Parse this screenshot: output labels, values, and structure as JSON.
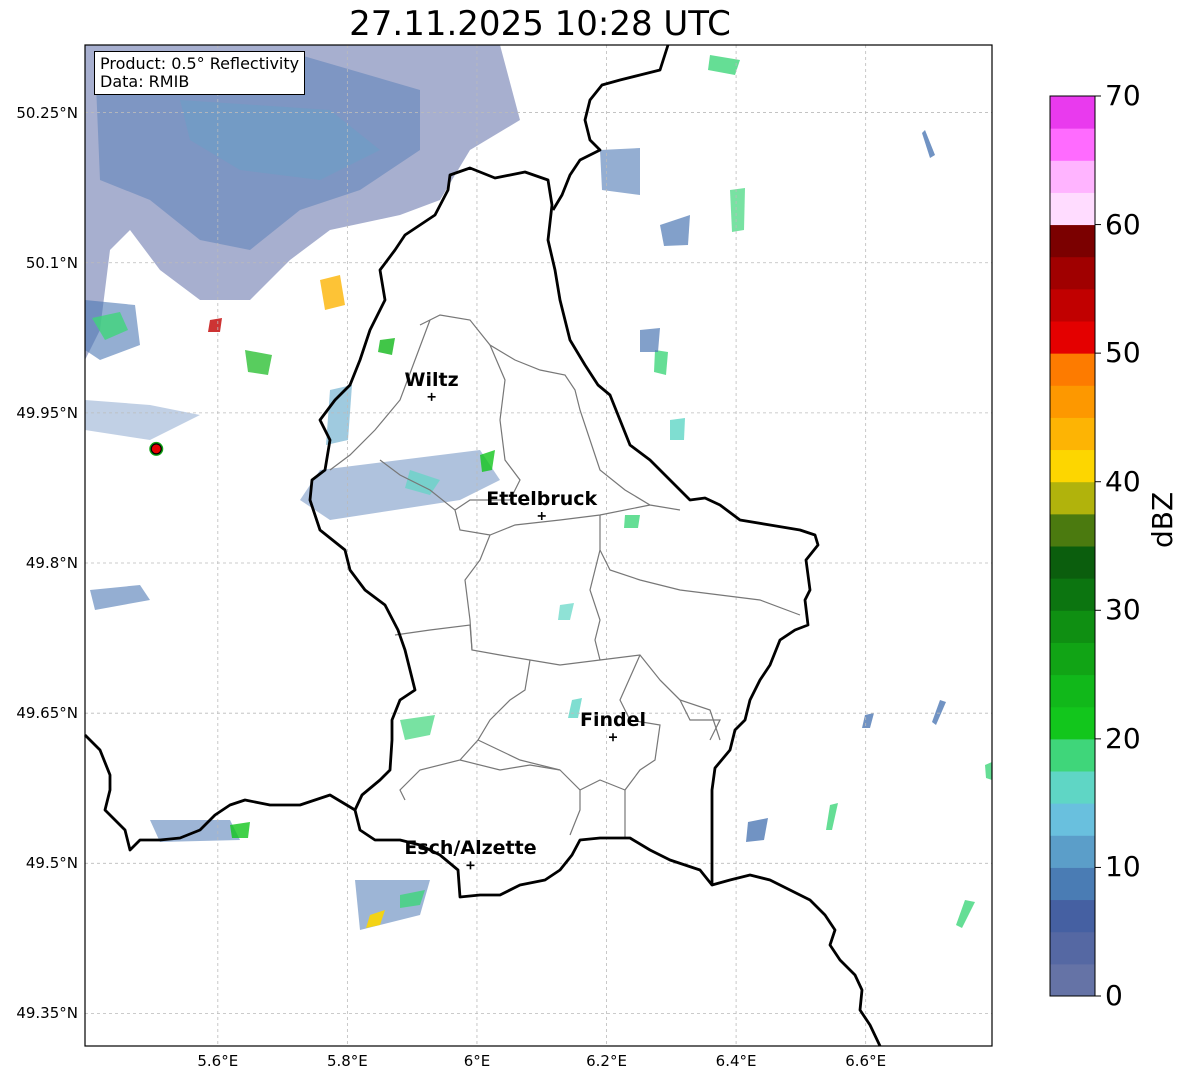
{
  "title": "27.11.2025 10:28 UTC",
  "info": {
    "product": "Product: 0.5° Reflectivity",
    "data": "Data: RMIB"
  },
  "axes": {
    "lat_labels": [
      "50.25°N",
      "50.1°N",
      "49.95°N",
      "49.8°N",
      "49.65°N",
      "49.5°N",
      "49.35°N"
    ],
    "lon_labels": [
      "5.6°E",
      "5.8°E",
      "6°E",
      "6.2°E",
      "6.4°E",
      "6.6°E"
    ],
    "lat_values": [
      50.25,
      50.1,
      49.95,
      49.8,
      49.65,
      49.5,
      49.35
    ],
    "lon_values": [
      5.6,
      5.8,
      6.0,
      6.2,
      6.4,
      6.6
    ]
  },
  "cities": [
    {
      "name": "Wiltz",
      "lon": 5.93,
      "lat": 49.966
    },
    {
      "name": "Ettelbruck",
      "lon": 6.1,
      "lat": 49.847
    },
    {
      "name": "Findel",
      "lon": 6.21,
      "lat": 49.626
    },
    {
      "name": "Esch/Alzette",
      "lon": 5.99,
      "lat": 49.498
    }
  ],
  "radar_site": {
    "lon": 5.505,
    "lat": 49.914
  },
  "colorbar": {
    "label": "dBZ",
    "ticks": [
      "0",
      "10",
      "20",
      "30",
      "40",
      "50",
      "60",
      "70"
    ],
    "colors": [
      "#6573a6",
      "#5568a3",
      "#4560a2",
      "#4a7cb4",
      "#5b9ec9",
      "#69c0de",
      "#5fd6c5",
      "#3fd67a",
      "#12c61c",
      "#11b81a",
      "#11a415",
      "#0f8f12",
      "#0c7510",
      "#0b5e0d",
      "#4b7a0f",
      "#b1b30c",
      "#fdd600",
      "#fdb404",
      "#fd9800",
      "#fd7b00",
      "#e40000",
      "#c10000",
      "#a00000",
      "#7b0000",
      "#ffdcff",
      "#ffb4ff",
      "#ff6bff",
      "#e93aee"
    ]
  },
  "colors": {
    "border": "#000000",
    "canton": "#777777",
    "grid": "#bbbbbb"
  }
}
